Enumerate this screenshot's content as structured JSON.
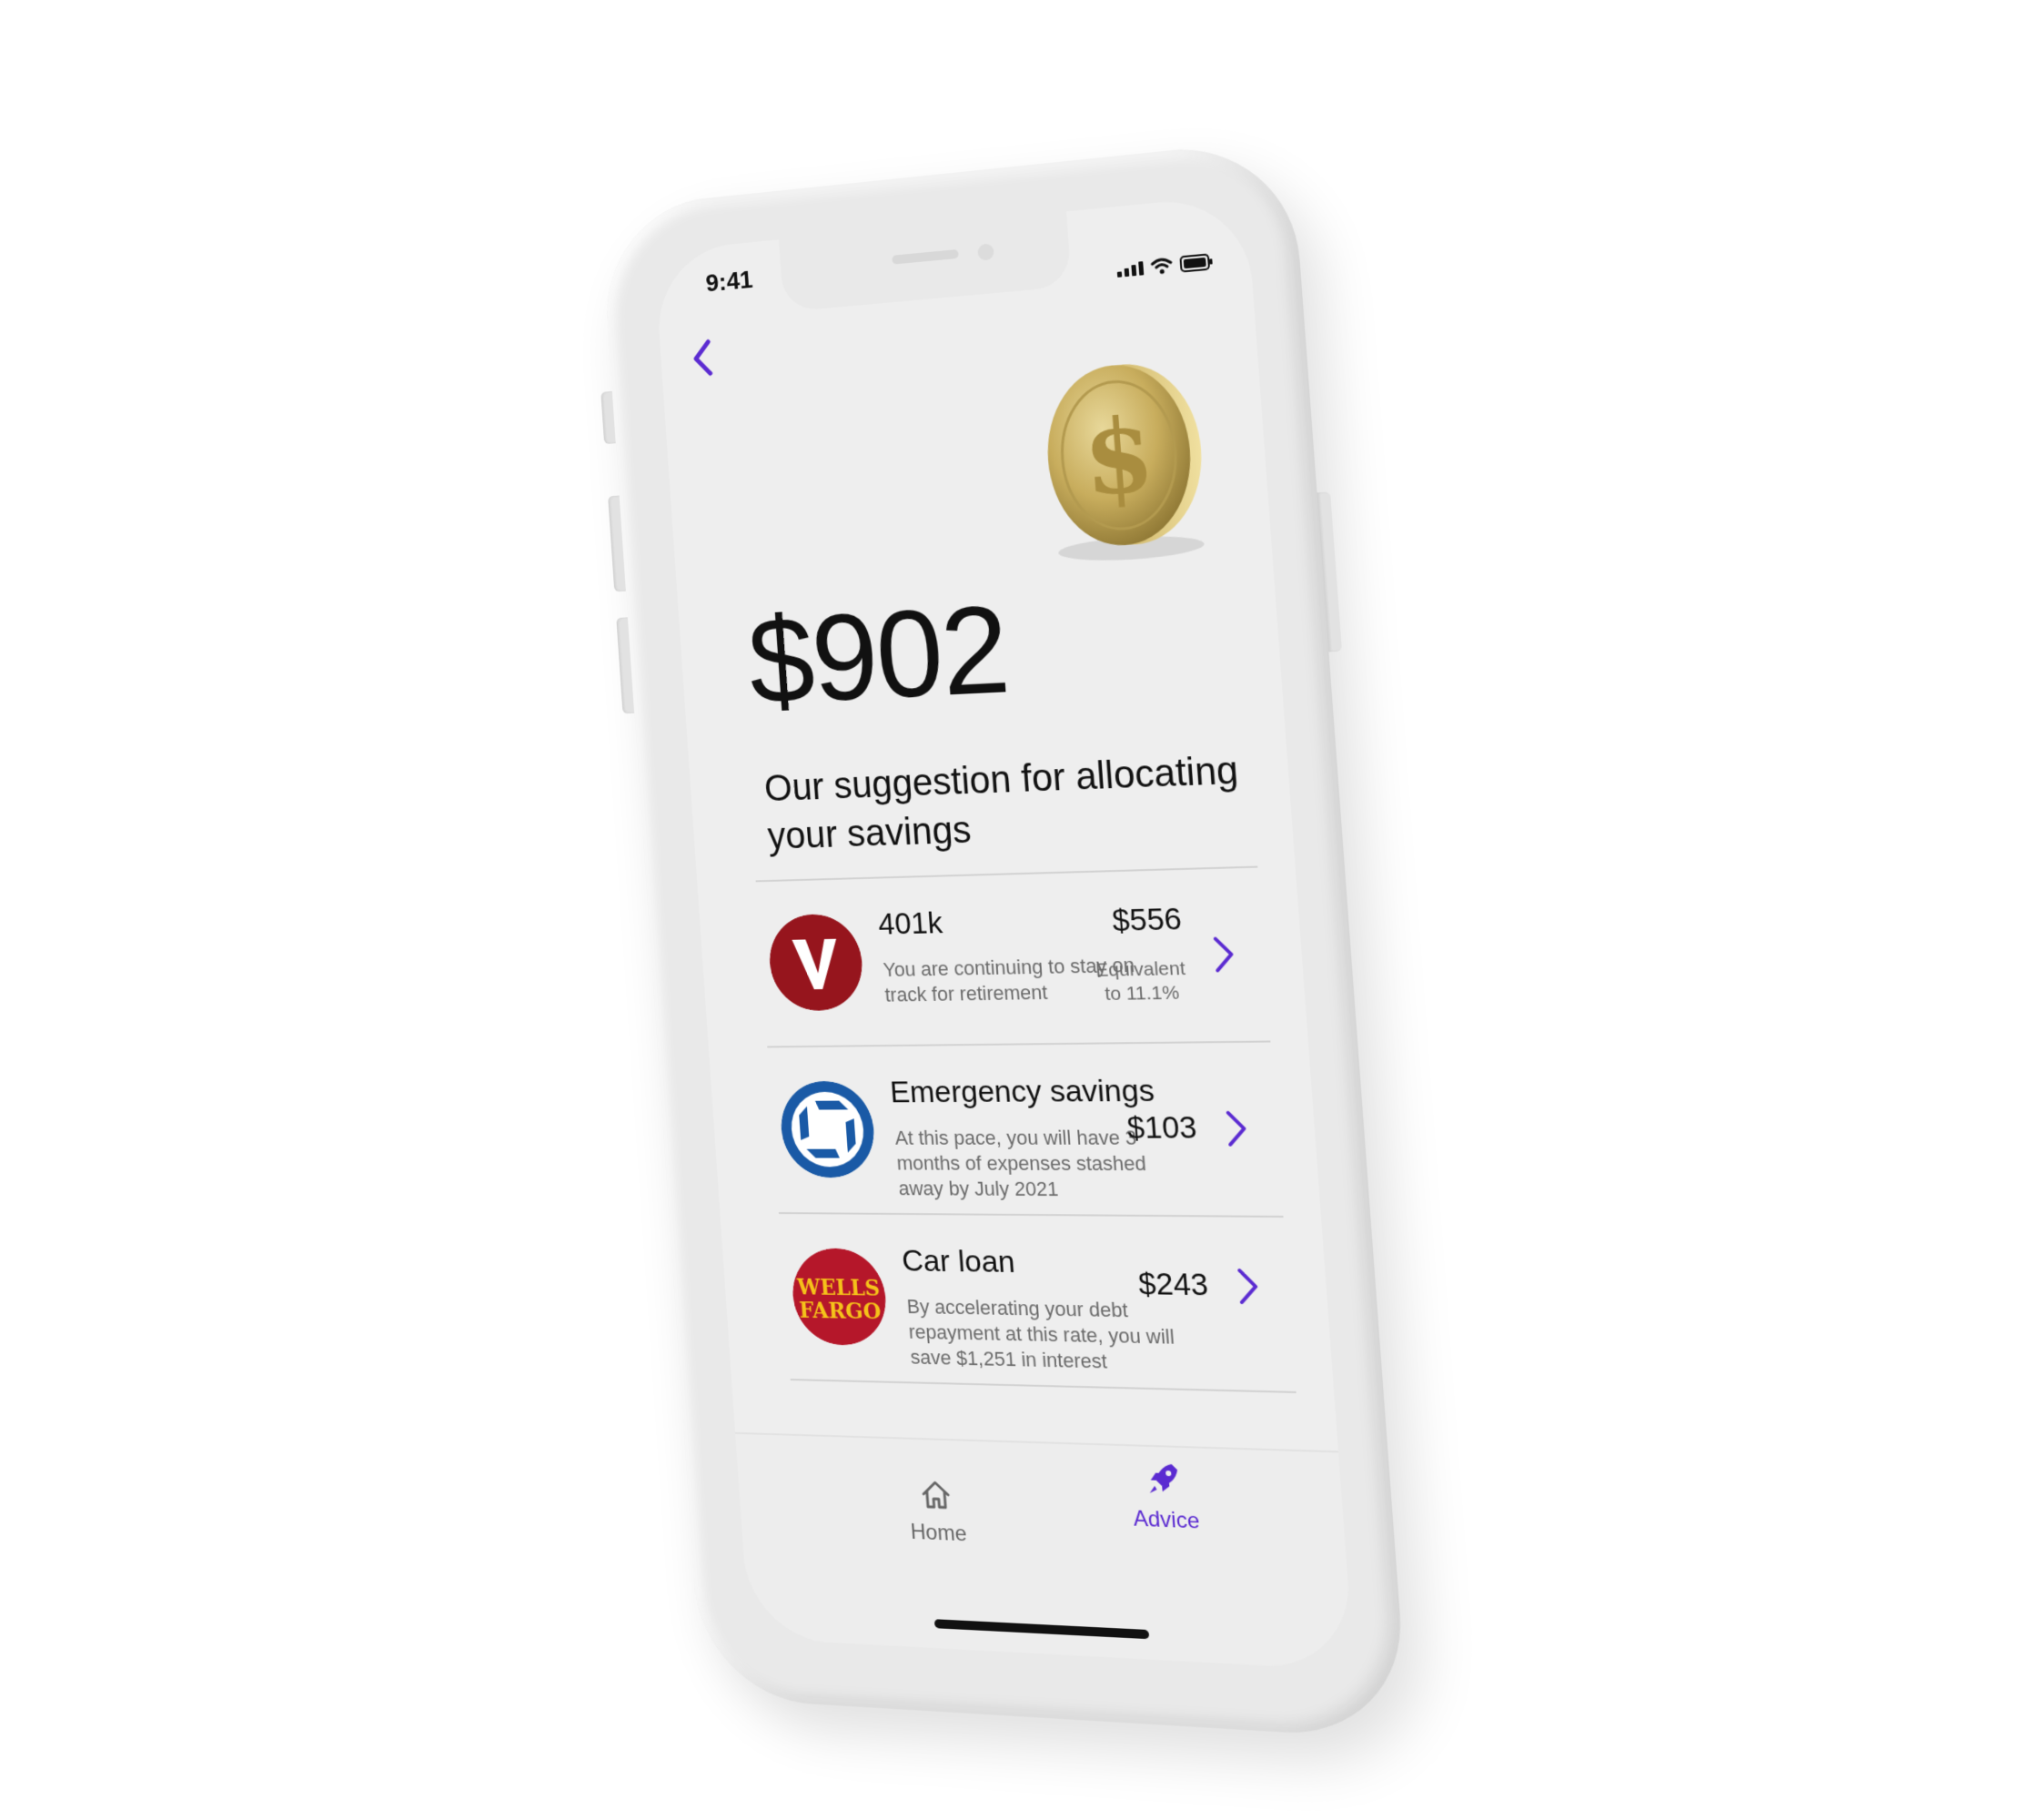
{
  "status_bar": {
    "time": "9:41"
  },
  "header": {
    "back_icon": "chevron-left-icon"
  },
  "hero": {
    "image": "gold-dollar-coin",
    "amount": "$902",
    "subtitle": "Our suggestion for allocating your savings"
  },
  "allocations": [
    {
      "logo": "vanguard-logo",
      "title": "401k",
      "description": "You are continuing to stay on track for retirement",
      "amount": "$556",
      "note": "Equivalent to 11.1%"
    },
    {
      "logo": "chase-logo",
      "title": "Emergency savings",
      "description": "At this pace, you will have 3 months of expenses stashed away by July 2021",
      "amount": "$103"
    },
    {
      "logo": "wells-fargo-logo",
      "title": "Car loan",
      "description": "By accelerating your debt repayment at this rate, you will save $1,251 in interest",
      "amount": "$243",
      "logo_text_line1": "WELLS",
      "logo_text_line2": "FARGO"
    }
  ],
  "tabbar": {
    "items": [
      {
        "label": "Home",
        "icon": "home-icon",
        "active": false
      },
      {
        "label": "Advice",
        "icon": "rocket-icon",
        "active": true
      }
    ]
  },
  "colors": {
    "accent": "#5b2bd1",
    "vanguard": "#96151d",
    "chase": "#1a5aa6",
    "wells_fargo": "#b5172a",
    "wells_fargo_text": "#f5c21a"
  }
}
